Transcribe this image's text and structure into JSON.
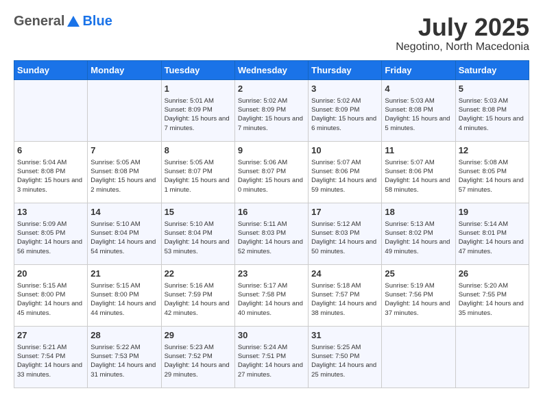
{
  "header": {
    "logo_general": "General",
    "logo_blue": "Blue",
    "month_year": "July 2025",
    "location": "Negotino, North Macedonia"
  },
  "weekdays": [
    "Sunday",
    "Monday",
    "Tuesday",
    "Wednesday",
    "Thursday",
    "Friday",
    "Saturday"
  ],
  "weeks": [
    [
      null,
      null,
      {
        "day": 1,
        "sunrise": "Sunrise: 5:01 AM",
        "sunset": "Sunset: 8:09 PM",
        "daylight": "Daylight: 15 hours and 7 minutes."
      },
      {
        "day": 2,
        "sunrise": "Sunrise: 5:02 AM",
        "sunset": "Sunset: 8:09 PM",
        "daylight": "Daylight: 15 hours and 7 minutes."
      },
      {
        "day": 3,
        "sunrise": "Sunrise: 5:02 AM",
        "sunset": "Sunset: 8:09 PM",
        "daylight": "Daylight: 15 hours and 6 minutes."
      },
      {
        "day": 4,
        "sunrise": "Sunrise: 5:03 AM",
        "sunset": "Sunset: 8:08 PM",
        "daylight": "Daylight: 15 hours and 5 minutes."
      },
      {
        "day": 5,
        "sunrise": "Sunrise: 5:03 AM",
        "sunset": "Sunset: 8:08 PM",
        "daylight": "Daylight: 15 hours and 4 minutes."
      }
    ],
    [
      {
        "day": 6,
        "sunrise": "Sunrise: 5:04 AM",
        "sunset": "Sunset: 8:08 PM",
        "daylight": "Daylight: 15 hours and 3 minutes."
      },
      {
        "day": 7,
        "sunrise": "Sunrise: 5:05 AM",
        "sunset": "Sunset: 8:08 PM",
        "daylight": "Daylight: 15 hours and 2 minutes."
      },
      {
        "day": 8,
        "sunrise": "Sunrise: 5:05 AM",
        "sunset": "Sunset: 8:07 PM",
        "daylight": "Daylight: 15 hours and 1 minute."
      },
      {
        "day": 9,
        "sunrise": "Sunrise: 5:06 AM",
        "sunset": "Sunset: 8:07 PM",
        "daylight": "Daylight: 15 hours and 0 minutes."
      },
      {
        "day": 10,
        "sunrise": "Sunrise: 5:07 AM",
        "sunset": "Sunset: 8:06 PM",
        "daylight": "Daylight: 14 hours and 59 minutes."
      },
      {
        "day": 11,
        "sunrise": "Sunrise: 5:07 AM",
        "sunset": "Sunset: 8:06 PM",
        "daylight": "Daylight: 14 hours and 58 minutes."
      },
      {
        "day": 12,
        "sunrise": "Sunrise: 5:08 AM",
        "sunset": "Sunset: 8:05 PM",
        "daylight": "Daylight: 14 hours and 57 minutes."
      }
    ],
    [
      {
        "day": 13,
        "sunrise": "Sunrise: 5:09 AM",
        "sunset": "Sunset: 8:05 PM",
        "daylight": "Daylight: 14 hours and 56 minutes."
      },
      {
        "day": 14,
        "sunrise": "Sunrise: 5:10 AM",
        "sunset": "Sunset: 8:04 PM",
        "daylight": "Daylight: 14 hours and 54 minutes."
      },
      {
        "day": 15,
        "sunrise": "Sunrise: 5:10 AM",
        "sunset": "Sunset: 8:04 PM",
        "daylight": "Daylight: 14 hours and 53 minutes."
      },
      {
        "day": 16,
        "sunrise": "Sunrise: 5:11 AM",
        "sunset": "Sunset: 8:03 PM",
        "daylight": "Daylight: 14 hours and 52 minutes."
      },
      {
        "day": 17,
        "sunrise": "Sunrise: 5:12 AM",
        "sunset": "Sunset: 8:03 PM",
        "daylight": "Daylight: 14 hours and 50 minutes."
      },
      {
        "day": 18,
        "sunrise": "Sunrise: 5:13 AM",
        "sunset": "Sunset: 8:02 PM",
        "daylight": "Daylight: 14 hours and 49 minutes."
      },
      {
        "day": 19,
        "sunrise": "Sunrise: 5:14 AM",
        "sunset": "Sunset: 8:01 PM",
        "daylight": "Daylight: 14 hours and 47 minutes."
      }
    ],
    [
      {
        "day": 20,
        "sunrise": "Sunrise: 5:15 AM",
        "sunset": "Sunset: 8:00 PM",
        "daylight": "Daylight: 14 hours and 45 minutes."
      },
      {
        "day": 21,
        "sunrise": "Sunrise: 5:15 AM",
        "sunset": "Sunset: 8:00 PM",
        "daylight": "Daylight: 14 hours and 44 minutes."
      },
      {
        "day": 22,
        "sunrise": "Sunrise: 5:16 AM",
        "sunset": "Sunset: 7:59 PM",
        "daylight": "Daylight: 14 hours and 42 minutes."
      },
      {
        "day": 23,
        "sunrise": "Sunrise: 5:17 AM",
        "sunset": "Sunset: 7:58 PM",
        "daylight": "Daylight: 14 hours and 40 minutes."
      },
      {
        "day": 24,
        "sunrise": "Sunrise: 5:18 AM",
        "sunset": "Sunset: 7:57 PM",
        "daylight": "Daylight: 14 hours and 38 minutes."
      },
      {
        "day": 25,
        "sunrise": "Sunrise: 5:19 AM",
        "sunset": "Sunset: 7:56 PM",
        "daylight": "Daylight: 14 hours and 37 minutes."
      },
      {
        "day": 26,
        "sunrise": "Sunrise: 5:20 AM",
        "sunset": "Sunset: 7:55 PM",
        "daylight": "Daylight: 14 hours and 35 minutes."
      }
    ],
    [
      {
        "day": 27,
        "sunrise": "Sunrise: 5:21 AM",
        "sunset": "Sunset: 7:54 PM",
        "daylight": "Daylight: 14 hours and 33 minutes."
      },
      {
        "day": 28,
        "sunrise": "Sunrise: 5:22 AM",
        "sunset": "Sunset: 7:53 PM",
        "daylight": "Daylight: 14 hours and 31 minutes."
      },
      {
        "day": 29,
        "sunrise": "Sunrise: 5:23 AM",
        "sunset": "Sunset: 7:52 PM",
        "daylight": "Daylight: 14 hours and 29 minutes."
      },
      {
        "day": 30,
        "sunrise": "Sunrise: 5:24 AM",
        "sunset": "Sunset: 7:51 PM",
        "daylight": "Daylight: 14 hours and 27 minutes."
      },
      {
        "day": 31,
        "sunrise": "Sunrise: 5:25 AM",
        "sunset": "Sunset: 7:50 PM",
        "daylight": "Daylight: 14 hours and 25 minutes."
      },
      null,
      null
    ]
  ]
}
